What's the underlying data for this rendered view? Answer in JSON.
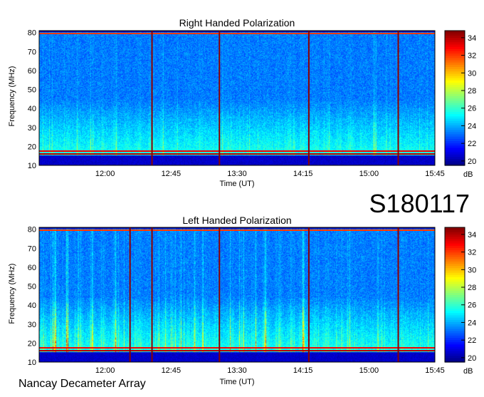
{
  "observatory": "Nancay Decameter Array",
  "date_code": "S180117",
  "colorbar": {
    "unit": "dB",
    "range": [
      19.5,
      34.8
    ],
    "ticks": [
      20,
      22,
      24,
      26,
      28,
      30,
      32,
      34
    ]
  },
  "chart_data": [
    {
      "type": "heatmap",
      "title": "Right Handed Polarization",
      "xlabel": "Time (UT)",
      "ylabel": "Frequency (MHz)",
      "xlim": [
        "11:15",
        "15:45"
      ],
      "ylim": [
        10,
        81
      ],
      "x_ticks": [
        "12:00",
        "12:45",
        "13:30",
        "14:15",
        "15:00",
        "15:45"
      ],
      "y_ticks": [
        10,
        20,
        30,
        40,
        50,
        60,
        70,
        80
      ],
      "colorbar_unit": "dB",
      "activity": 0.45,
      "vertical_lines": [
        "12:32",
        "13:18",
        "14:19",
        "15:20"
      ],
      "horizontal_bands": [
        {
          "freq": 16,
          "level": 34
        },
        {
          "freq": 17.5,
          "level": 33
        },
        {
          "freq": 79.5,
          "level": 32
        }
      ]
    },
    {
      "type": "heatmap",
      "title": "Left Handed Polarization",
      "xlabel": "Time (UT)",
      "ylabel": "Frequency (MHz)",
      "xlim": [
        "11:15",
        "15:45"
      ],
      "ylim": [
        10,
        81
      ],
      "x_ticks": [
        "12:00",
        "12:45",
        "13:30",
        "14:15",
        "15:00",
        "15:45"
      ],
      "y_ticks": [
        10,
        20,
        30,
        40,
        50,
        60,
        70,
        80
      ],
      "colorbar_unit": "dB",
      "activity": 0.75,
      "vertical_lines": [
        "12:17",
        "12:32",
        "13:18",
        "14:19",
        "15:20"
      ],
      "horizontal_bands": [
        {
          "freq": 16,
          "level": 34
        },
        {
          "freq": 17.5,
          "level": 33
        },
        {
          "freq": 79.5,
          "level": 32
        }
      ]
    }
  ]
}
